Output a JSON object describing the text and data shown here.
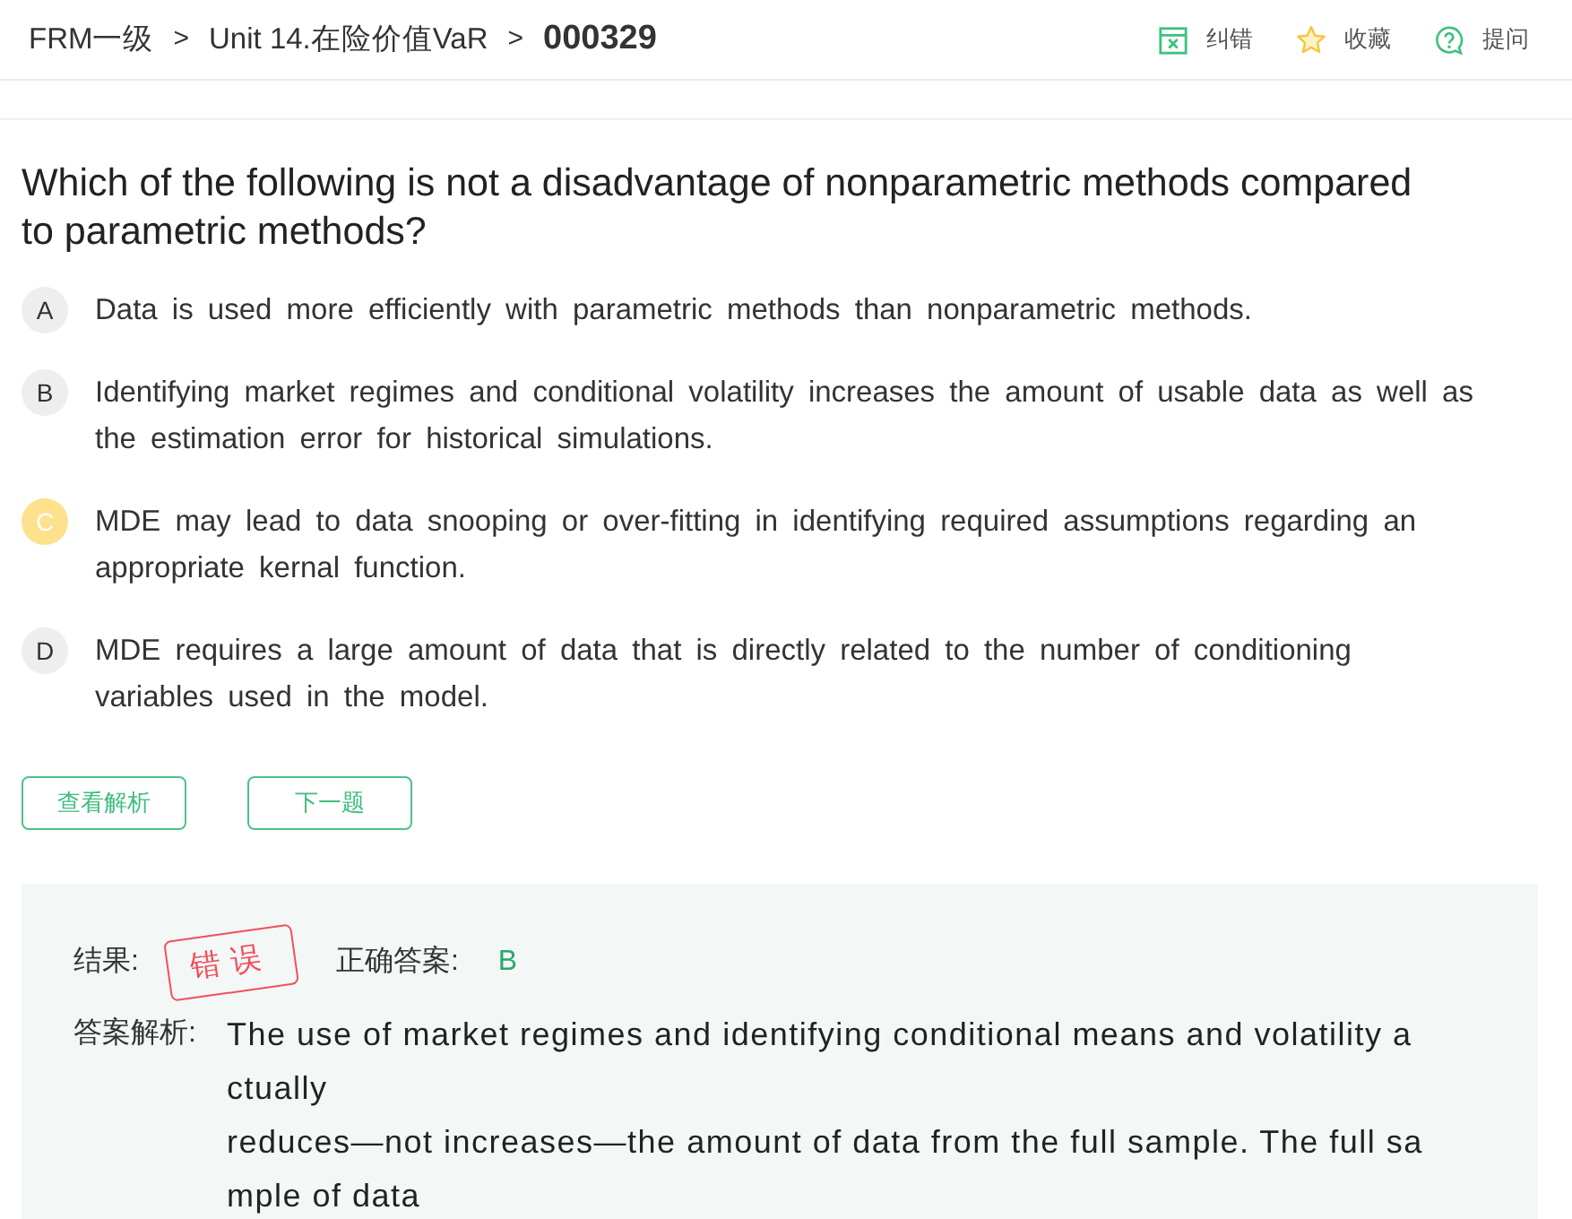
{
  "breadcrumb": {
    "items": [
      "FRM一级",
      "Unit 14.在险价值VaR"
    ],
    "separators": [
      ">",
      ">"
    ],
    "current": "000329"
  },
  "actions": [
    {
      "kind": "report",
      "label": "纠错"
    },
    {
      "kind": "favorite",
      "label": "收藏"
    },
    {
      "kind": "ask",
      "label": "提问"
    }
  ],
  "question": {
    "text": "Which of the following is not a disadvantage of nonparametric methods compared to parametric methods?"
  },
  "options": [
    {
      "letter": "A",
      "text": "Data is used more efficiently with parametric methods than nonparametric methods.",
      "selected": false
    },
    {
      "letter": "B",
      "text": "Identifying market regimes and conditional volatility increases the amount of usable data as well as the estimation error for historical simulations.",
      "selected": false
    },
    {
      "letter": "C",
      "text": "MDE may lead to data snooping or over-fitting in identifying required assumptions regarding an appropriate kernal function.",
      "selected": true
    },
    {
      "letter": "D",
      "text": "MDE requires a large amount of data that is directly related to the number of conditioning variables used in the model.",
      "selected": false
    }
  ],
  "buttons": [
    "查看解析",
    "下一题"
  ],
  "result": {
    "result_label": "结果:",
    "stamp": "错误",
    "is_correct": false,
    "correct_label": "正确答案:",
    "correct_answer": "B",
    "explanation_label": "答案解析:",
    "explanation_lines": [
      "The use of market regimes and identifying conditional means and volatility actually",
      "reduces—not increases—the amount of data from the full sample. The full sample of data"
    ]
  }
}
